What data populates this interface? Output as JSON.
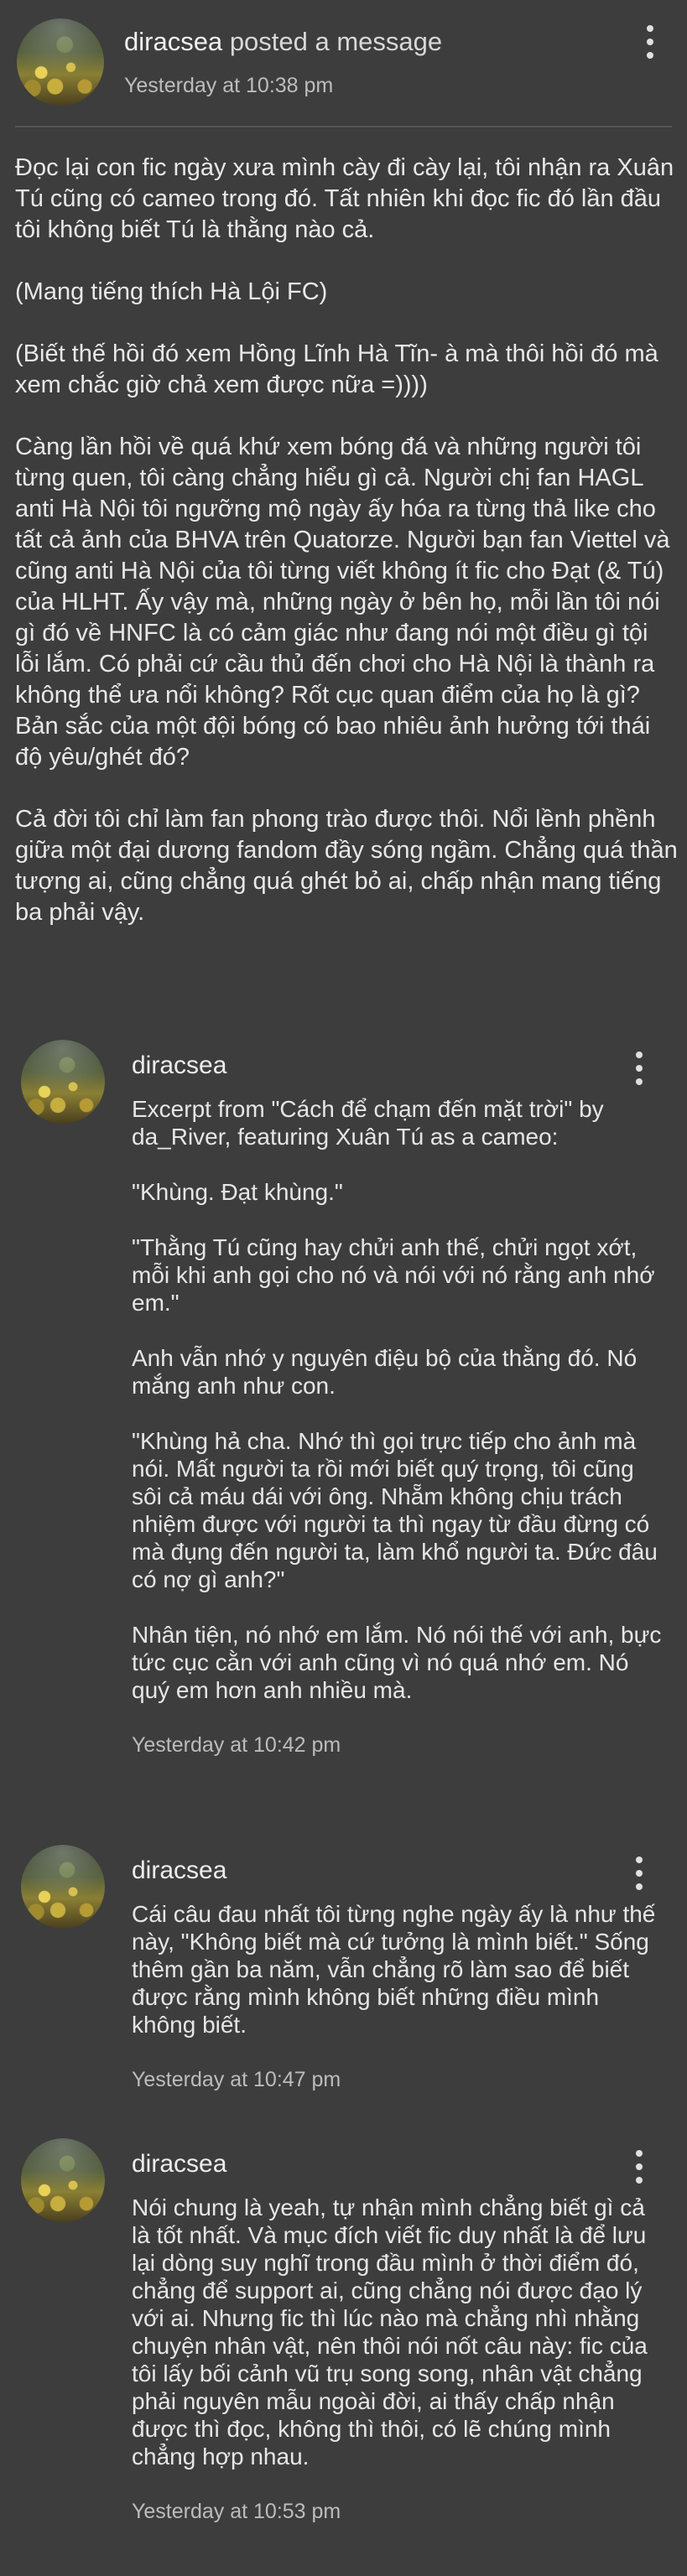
{
  "post": {
    "author": "diracsea",
    "action": "posted a message",
    "timestamp": "Yesterday at 10:38 pm",
    "paragraphs": [
      "Đọc lại con fic ngày xưa mình cày đi cày lại, tôi nhận ra Xuân Tú cũng có cameo trong đó. Tất nhiên khi đọc fic đó lần đầu tôi không biết Tú là thằng nào cả.",
      "(Mang tiếng thích Hà Lội FC)",
      "(Biết thế hồi đó xem Hồng Lĩnh Hà Tĩn- à mà thôi hồi đó mà xem chắc giờ chả xem được nữa =))))",
      "Càng lần hồi về quá khứ xem bóng đá và những người tôi từng quen, tôi càng chẳng hiểu gì cả. Người chị fan HAGL anti Hà Nội tôi ngưỡng mộ ngày ấy hóa ra từng thả like cho tất cả ảnh của BHVA trên Quatorze. Người bạn fan Viettel và cũng anti Hà Nội của tôi từng viết không ít fic cho Đạt (& Tú) của HLHT. Ấy vậy mà, những ngày ở bên họ, mỗi lần tôi nói gì đó về HNFC là có cảm giác như đang nói một điều gì tội lỗi lắm. Có phải cứ cầu thủ đến chơi cho Hà Nội là thành ra không thể ưa nổi không? Rốt cục quan điểm của họ là gì? Bản sắc của một đội bóng có bao nhiêu ảnh hưởng tới thái độ yêu/ghét đó?",
      "Cả đời tôi chỉ làm fan phong trào được thôi. Nổi lềnh phềnh giữa một đại dương fandom đầy sóng ngầm. Chẳng quá thần tượng ai, cũng chẳng quá ghét bỏ ai, chấp nhận mang tiếng ba phải vậy."
    ]
  },
  "comments": [
    {
      "author": "diracsea",
      "paragraphs": [
        "Excerpt from \"Cách để chạm đến mặt trời\" by da_River, featuring Xuân Tú as a cameo:",
        "\"Khùng. Đạt khùng.\"",
        "\"Thằng Tú cũng hay chửi anh thế, chửi ngọt xớt, mỗi khi anh gọi cho nó và nói với nó rằng anh nhớ em.\"",
        "Anh vẫn nhớ y nguyên điệu bộ của thằng đó. Nó mắng anh như con.",
        "\"Khùng hả cha. Nhớ thì gọi trực tiếp cho ảnh mà nói. Mất người ta rồi mới biết quý trọng, tôi cũng sôi cả máu dái với ông. Nhẵm không chịu trách nhiệm được với người ta thì ngay từ đầu đừng có mà đụng đến người ta, làm khổ người ta. Đức đâu có nợ gì anh?\"",
        "Nhân tiện, nó nhớ em lắm. Nó nói thế với anh, bực tức cục cằn với anh cũng vì nó quá nhớ em. Nó quý em hơn anh nhiều mà."
      ],
      "timestamp": "Yesterday at 10:42 pm"
    },
    {
      "author": "diracsea",
      "paragraphs": [
        "Cái câu đau nhất tôi từng nghe ngày ấy là như thế này, \"Không biết mà cứ tưởng là mình biết.\" Sống thêm gần ba năm, vẫn chẳng rõ làm sao để biết được rằng mình không biết những điều mình không biết."
      ],
      "timestamp": "Yesterday at 10:47 pm"
    },
    {
      "author": "diracsea",
      "paragraphs": [
        "Nói chung là yeah, tự nhận mình chẳng biết gì cả là tốt nhất. Và mục đích viết fic duy nhất là để lưu lại dòng suy nghĩ trong đầu mình ở thời điểm đó, chẳng để support ai, cũng chẳng nói được đạo lý với ai. Nhưng fic thì lúc nào mà chẳng nhì nhằng chuyện nhân vật, nên thôi nói nốt câu này: fic của tôi lấy bối cảnh vũ trụ song song, nhân vật chẳng phải nguyên mẫu ngoài đời, ai thấy chấp nhận được thì đọc, không thì thôi, có lẽ chúng mình chẳng hợp nhau."
      ],
      "timestamp": "Yesterday at 10:53 pm"
    }
  ]
}
